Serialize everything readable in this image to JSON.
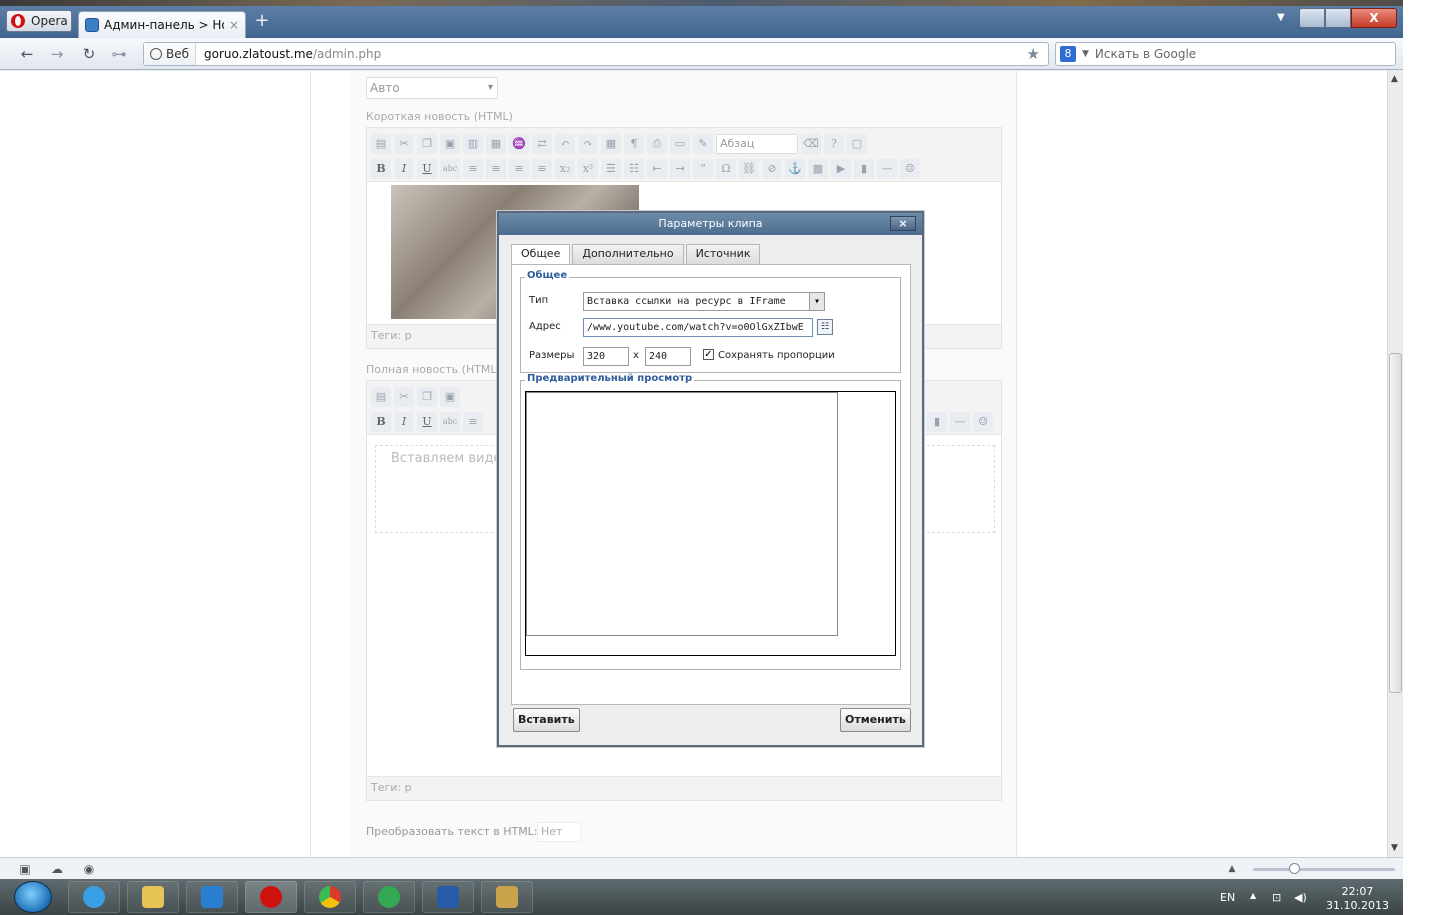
{
  "browser": {
    "menu_label": "Opera",
    "tab_title": "Админ-панель > Нов...",
    "tab_close": "×",
    "new_tab": "+",
    "url_badge": "Веб",
    "url_host": "goruo.zlatoust.me",
    "url_path": "/admin.php",
    "search_placeholder": "Искать в Google",
    "search_engine_glyph": "8"
  },
  "page": {
    "category_select": "Авто",
    "short_news_label": "Короткая новость (HTML)",
    "full_news_label": "Полная новость (HTML)",
    "format_combo": "Абзац",
    "tags_label_1": "Теги: p",
    "tags_label_2": "Теги: p",
    "full_news_placeholder": "Вставляем виде",
    "convert_label": "Преобразовать текст в HTML:",
    "convert_value": "Нет"
  },
  "dialog": {
    "title": "Параметры клипа",
    "close": "×",
    "tabs": [
      "Общее",
      "Дополнительно",
      "Источник"
    ],
    "general_legend": "Общее",
    "type_label": "Тип",
    "type_value": "Вставка ссылки на ресурс в IFrame",
    "address_label": "Адрес",
    "address_value": "/www.youtube.com/watch?v=o0OlGxZIbwE",
    "size_label": "Размеры",
    "width_value": "320",
    "times": "x",
    "height_value": "240",
    "keep_ratio_label": "Сохранять пропорции",
    "keep_ratio_checked": true,
    "preview_legend": "Предварительный просмотр",
    "insert_button": "Вставить",
    "cancel_button": "Отменить"
  },
  "tray": {
    "lang": "EN",
    "time": "22:07",
    "date": "31.10.2013"
  },
  "colors": {
    "titlebar": "#4f7199",
    "dialog_title": "#5a7c9d",
    "legend": "#2f5d9a"
  }
}
